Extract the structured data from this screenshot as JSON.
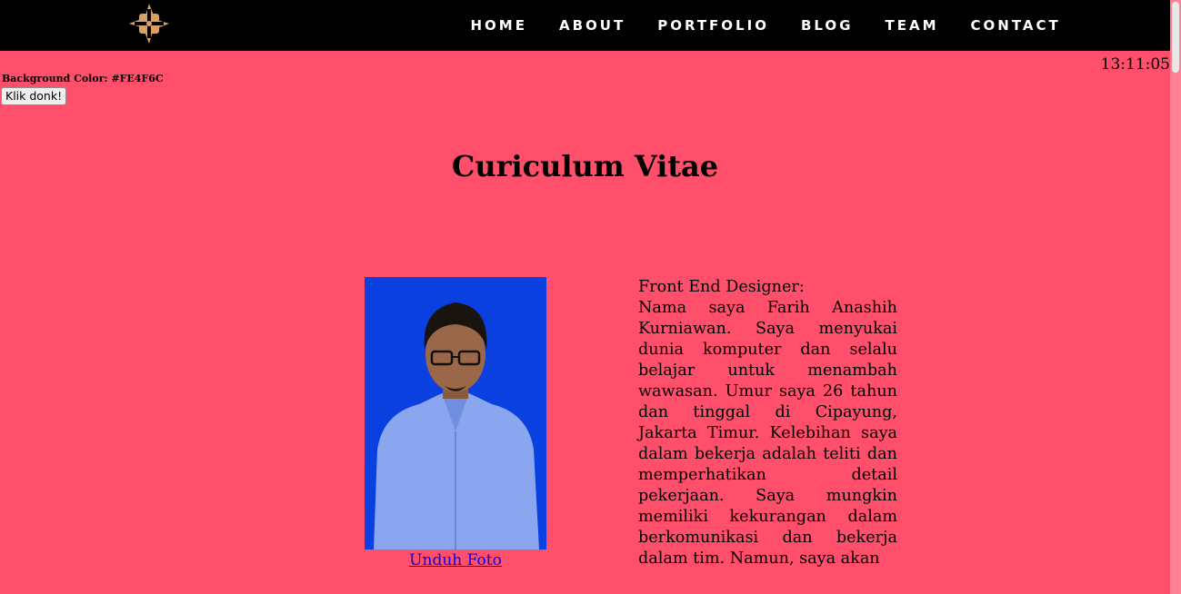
{
  "nav": {
    "items": [
      "HOME",
      "ABOUT",
      "PORTFOLIO",
      "BLOG",
      "TEAM",
      "CONTACT"
    ]
  },
  "clock": "13:11:05",
  "background_label": "Background Color: #FE4F6C",
  "button_label": "Klik donk!",
  "page_title": "Curiculum Vitae",
  "profile": {
    "download_label": "Unduh Foto",
    "role": "Front End Designer:",
    "bio": "Nama saya Farih Anashih Kurniawan. Saya menyukai dunia komputer dan selalu belajar untuk menambah wawasan. Umur saya 26 tahun dan tinggal di Cipayung, Jakarta Timur. Kelebihan saya dalam bekerja adalah teliti dan memperhatikan detail pekerjaan. Saya mungkin memiliki kekurangan dalam berkomunikasi dan bekerja dalam tim. Namun, saya akan"
  },
  "colors": {
    "page_background": "#FE4F6C",
    "topbar": "#000000",
    "logo": "#D9A066",
    "photo_background": "#0A3FE0"
  },
  "icons": {
    "logo": "compass-cross-logo-icon"
  }
}
